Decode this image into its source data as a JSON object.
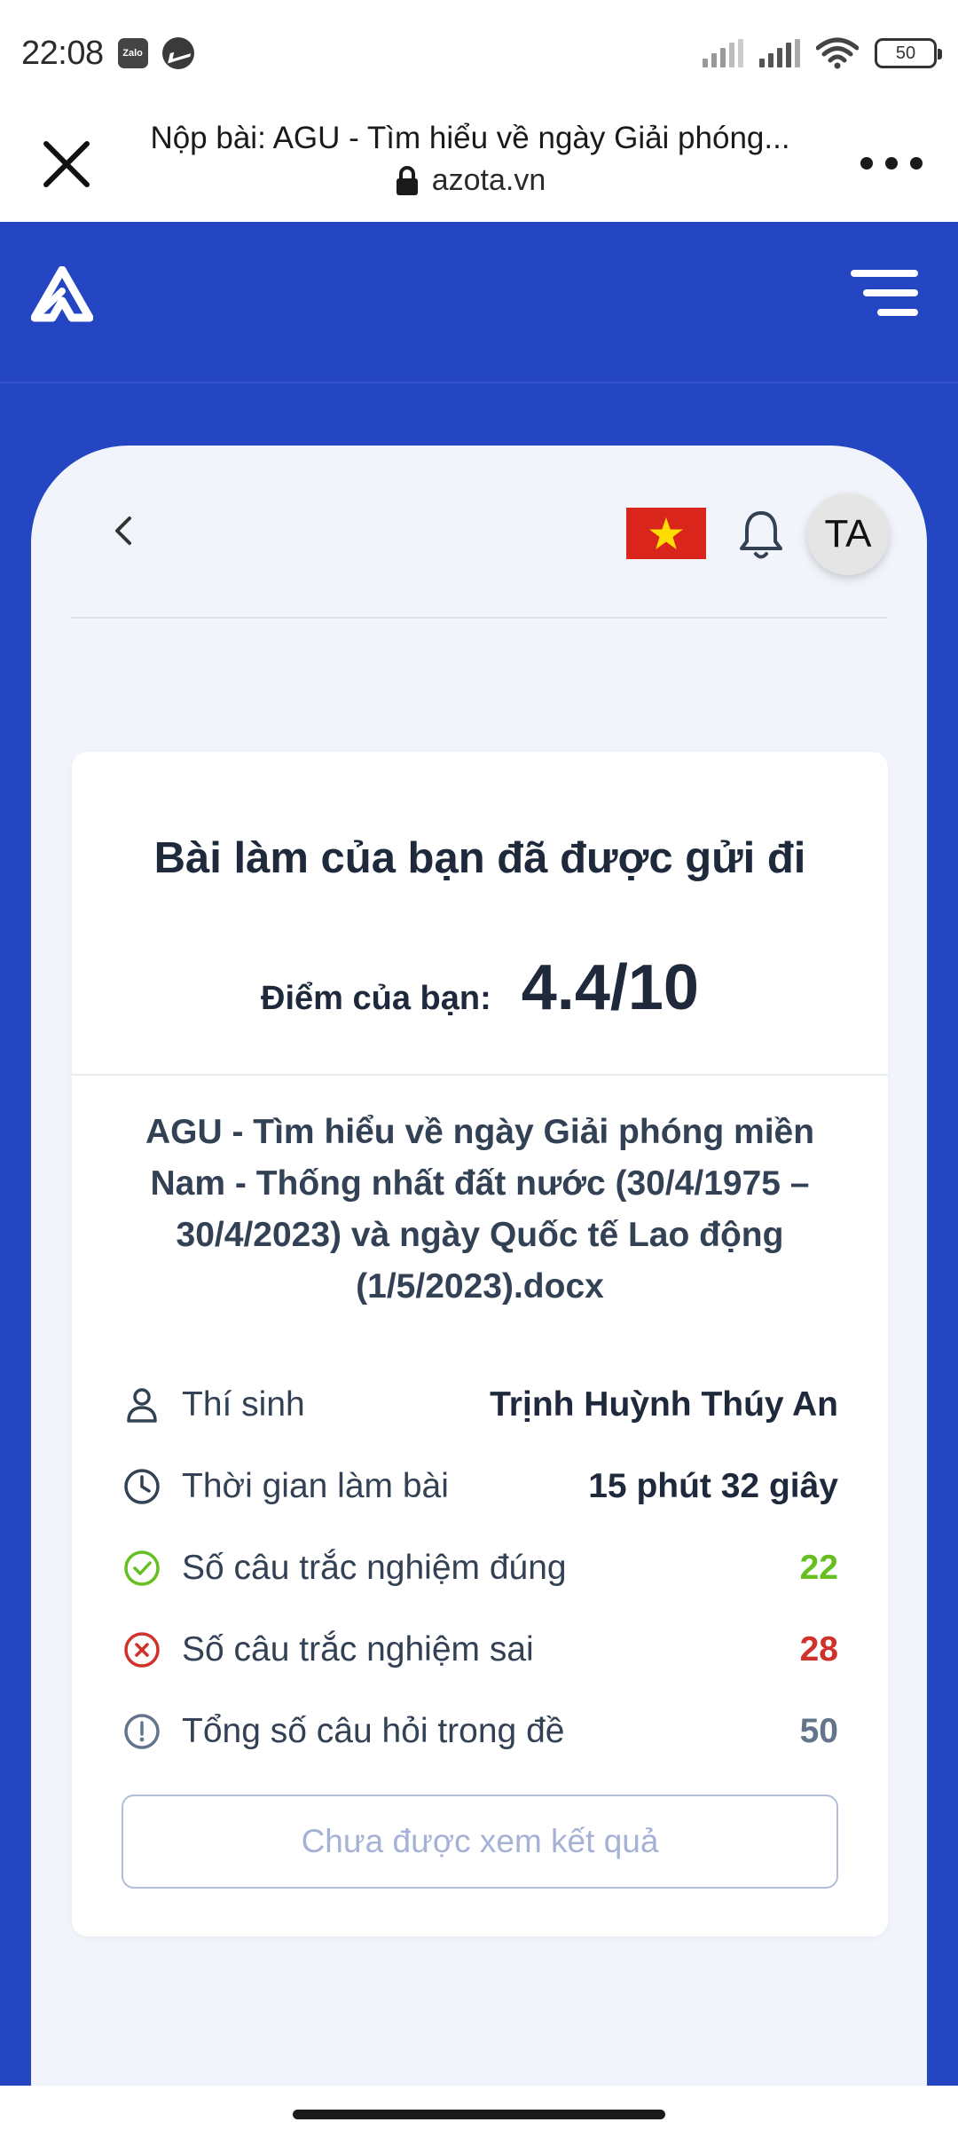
{
  "status_bar": {
    "time": "22:08",
    "app_badge": "Zalo",
    "battery": "50"
  },
  "browser": {
    "title": "Nộp bài: AGU - Tìm hiểu về ngày Giải phóng...",
    "url": "azota.vn"
  },
  "panel": {
    "avatar_initials": "TA"
  },
  "result": {
    "title": "Bài làm của bạn đã được gửi đi",
    "score_label": "Điểm của bạn:",
    "score_value": "4.4/10",
    "document_name": "AGU - Tìm hiểu về ngày Giải phóng miền Nam - Thống nhất đất nước (30/4/1975 – 30/4/2023) và ngày Quốc tế Lao động (1/5/2023).docx",
    "rows": [
      {
        "icon": "user-icon",
        "label": "Thí sinh",
        "value": "Trịnh Huỳnh Thúy An"
      },
      {
        "icon": "clock-icon",
        "label": "Thời gian làm bài",
        "value": "15 phút 32 giây"
      },
      {
        "icon": "check-circle-icon",
        "label": "Số câu trắc nghiệm đúng",
        "value": "22"
      },
      {
        "icon": "x-circle-icon",
        "label": "Số câu trắc nghiệm sai",
        "value": "28"
      },
      {
        "icon": "exclamation-circle-icon",
        "label": "Tổng số câu hỏi trong đề",
        "value": "50"
      }
    ],
    "button_label": "Chưa được xem kết quả"
  },
  "colors": {
    "brand_blue": "#2446c3",
    "correct_green": "#65c01f",
    "wrong_red": "#d0312b",
    "neutral_gray": "#64748b"
  }
}
